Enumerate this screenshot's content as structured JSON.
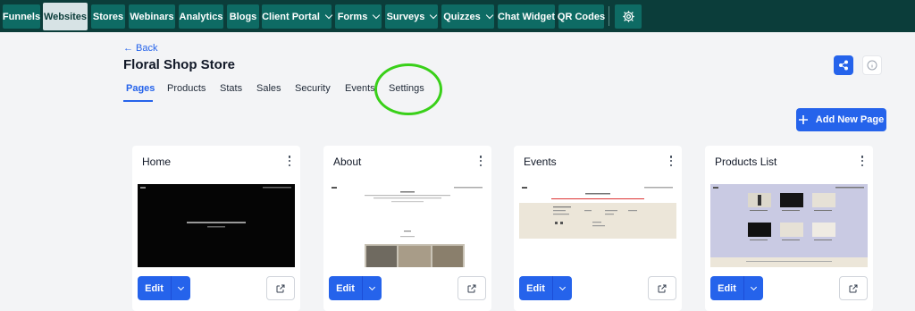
{
  "nav": {
    "items": [
      {
        "label": "Funnels",
        "dropdown": false,
        "active": false
      },
      {
        "label": "Websites",
        "dropdown": false,
        "active": true
      },
      {
        "label": "Stores",
        "dropdown": false,
        "active": false
      },
      {
        "label": "Webinars",
        "dropdown": false,
        "active": false
      },
      {
        "label": "Analytics",
        "dropdown": false,
        "active": false
      },
      {
        "label": "Blogs",
        "dropdown": false,
        "active": false
      },
      {
        "label": "Client Portal",
        "dropdown": true,
        "active": false
      },
      {
        "label": "Forms",
        "dropdown": true,
        "active": false
      },
      {
        "label": "Surveys",
        "dropdown": true,
        "active": false
      },
      {
        "label": "Quizzes",
        "dropdown": true,
        "active": false
      },
      {
        "label": "Chat Widget",
        "dropdown": false,
        "active": false
      },
      {
        "label": "QR Codes",
        "dropdown": false,
        "active": false
      }
    ],
    "settings_icon": "gear-icon"
  },
  "header": {
    "back_label": "← Back",
    "title": "Floral Shop Store",
    "share_icon": "share-icon",
    "info_icon": "info-icon"
  },
  "tabs": [
    {
      "label": "Pages",
      "active": true
    },
    {
      "label": "Products",
      "active": false
    },
    {
      "label": "Stats",
      "active": false
    },
    {
      "label": "Sales",
      "active": false
    },
    {
      "label": "Security",
      "active": false
    },
    {
      "label": "Events",
      "active": false
    },
    {
      "label": "Settings",
      "active": false
    }
  ],
  "actions": {
    "add_page_label": "Add New Page",
    "add_icon": "plus-icon"
  },
  "cards": [
    {
      "title": "Home",
      "edit_label": "Edit"
    },
    {
      "title": "About",
      "edit_label": "Edit"
    },
    {
      "title": "Events",
      "edit_label": "Edit"
    },
    {
      "title": "Products List",
      "edit_label": "Edit"
    }
  ],
  "colors": {
    "nav_bg": "#0b3d3a",
    "nav_item": "#0e6b64",
    "accent": "#2563eb",
    "highlight": "#39d019"
  }
}
